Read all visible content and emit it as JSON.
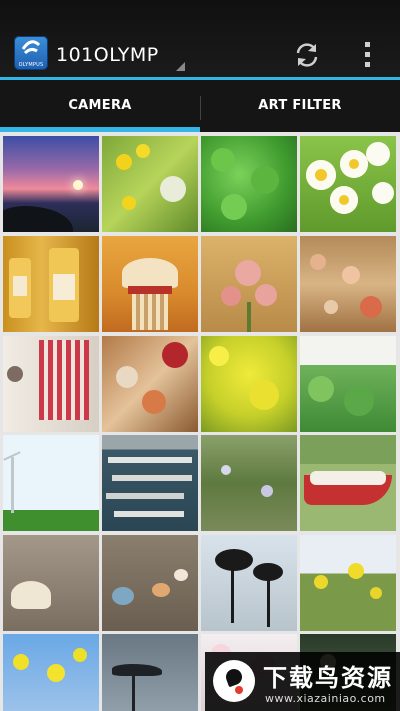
{
  "actionbar": {
    "title": "101OLYMP",
    "logo_text": "OLYMPUS",
    "logo_icon": "olympus-app-icon",
    "refresh_icon": "refresh-icon",
    "overflow_icon": "overflow-menu-icon"
  },
  "tabs": [
    {
      "label": "CAMERA",
      "active": true
    },
    {
      "label": "ART FILTER",
      "active": false
    }
  ],
  "colors": {
    "accent": "#33b5e5",
    "actionbar_bg": "#151515"
  },
  "thumbnails": [
    {
      "subject": "sunset-sea"
    },
    {
      "subject": "yellow-flowers-dandelion"
    },
    {
      "subject": "clover-leaves"
    },
    {
      "subject": "white-daisies"
    },
    {
      "subject": "glass-bottles"
    },
    {
      "subject": "wind-chime"
    },
    {
      "subject": "pink-flower-sepia"
    },
    {
      "subject": "hanging-shells"
    },
    {
      "subject": "shell-mobile"
    },
    {
      "subject": "shells-colorful"
    },
    {
      "subject": "yellow-rapeseed"
    },
    {
      "subject": "green-vegetables"
    },
    {
      "subject": "wind-turbine"
    },
    {
      "subject": "harbor-boats"
    },
    {
      "subject": "grass-field"
    },
    {
      "subject": "red-boat"
    },
    {
      "subject": "shell-on-sand"
    },
    {
      "subject": "shells-on-beach"
    },
    {
      "subject": "palm-trees-silhouette"
    },
    {
      "subject": "yellow-flowers-sky"
    },
    {
      "subject": "yellow-flowers-blue-sky"
    },
    {
      "subject": "weathervane"
    },
    {
      "subject": "cherry-blossom"
    },
    {
      "subject": "flowers-dark"
    }
  ],
  "watermark": {
    "title": "下载鸟资源",
    "url": "www.xiazainiao.com"
  }
}
